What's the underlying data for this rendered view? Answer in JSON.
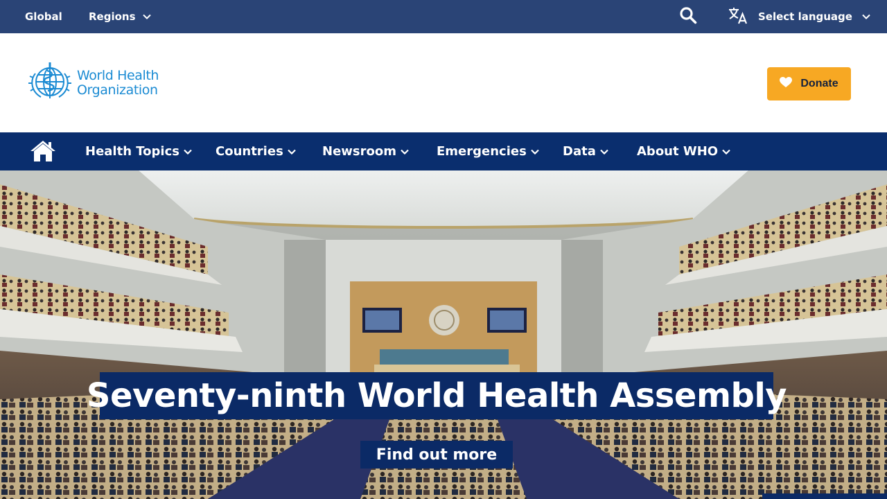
{
  "topbar": {
    "global_label": "Global",
    "regions_label": "Regions",
    "search_icon": "search-icon",
    "language_label": "Select language"
  },
  "header": {
    "logo_line1": "World Health",
    "logo_line2": "Organization",
    "donate_label": "Donate"
  },
  "nav": {
    "items": [
      {
        "label": "Health Topics"
      },
      {
        "label": "Countries"
      },
      {
        "label": "Newsroom"
      },
      {
        "label": "Emergencies"
      },
      {
        "label": "Data"
      },
      {
        "label": "About WHO"
      }
    ]
  },
  "hero": {
    "title": "Seventy-ninth World Health Assembly",
    "cta_label": "Find out more"
  },
  "colors": {
    "topbar": "#2a4476",
    "nav": "#0a2e6e",
    "hero_banner": "#0b2a66",
    "donate": "#f7a823",
    "logo": "#1b8bd3"
  }
}
